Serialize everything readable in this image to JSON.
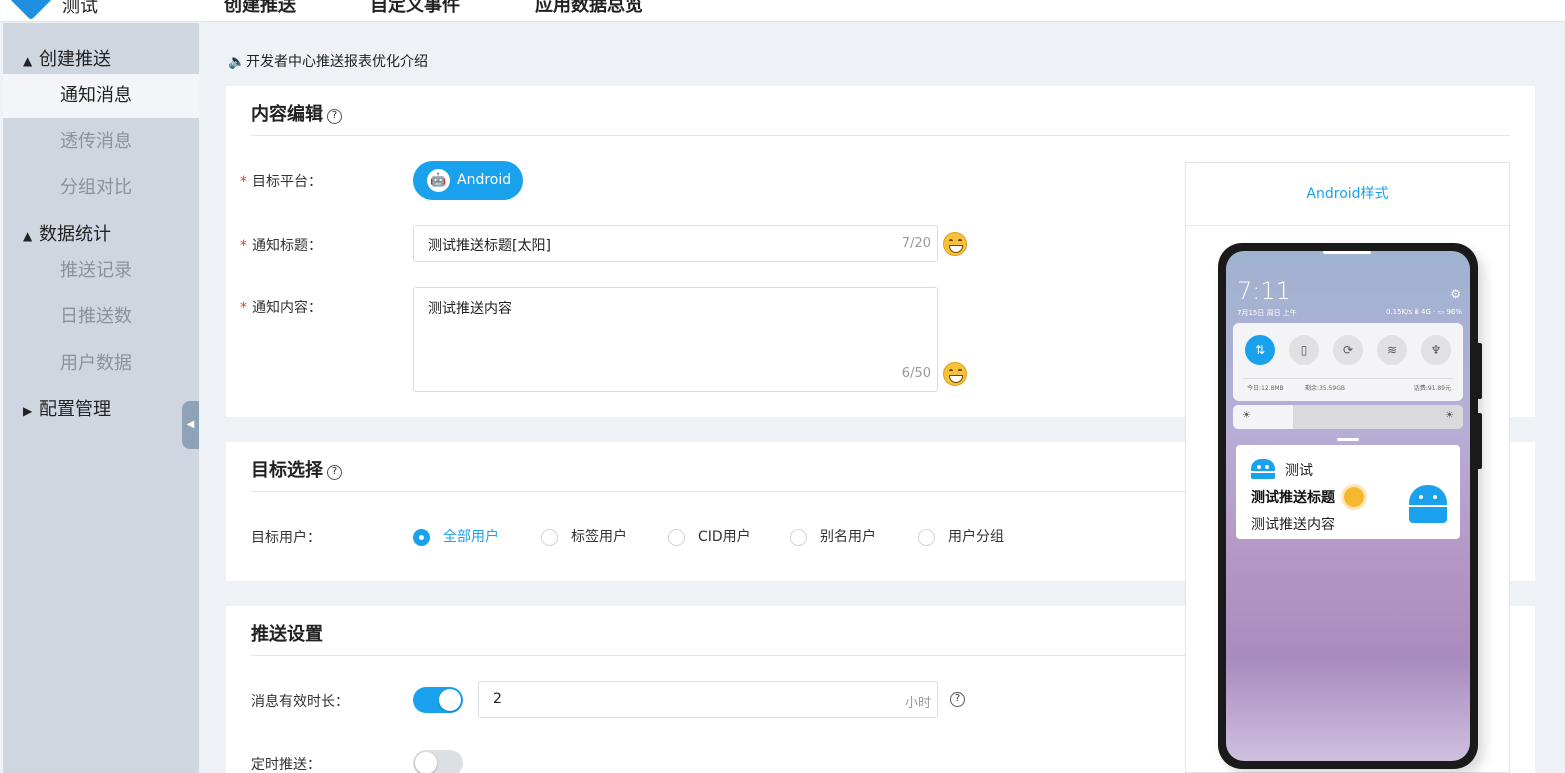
{
  "header": {
    "app_name": "测试",
    "nav": [
      "创建推送",
      "自定义事件",
      "应用数据总览"
    ]
  },
  "sidebar": {
    "groups": [
      {
        "label": "创建推送",
        "items": [
          "通知消息",
          "透传消息",
          "分组对比"
        ]
      },
      {
        "label": "数据统计",
        "items": [
          "推送记录",
          "日推送数",
          "用户数据"
        ]
      },
      {
        "label": "配置管理",
        "items": []
      }
    ],
    "active_item": "通知消息"
  },
  "notice": "开发者中心推送报表优化介绍",
  "content_edit": {
    "title": "内容编辑",
    "platform_label": "目标平台：",
    "platform_value": "Android",
    "title_label": "通知标题：",
    "title_value": "测试推送标题[太阳]",
    "title_count": "7/20",
    "content_label": "通知内容：",
    "content_value": "测试推送内容",
    "content_count": "6/50"
  },
  "target": {
    "title": "目标选择",
    "label": "目标用户：",
    "options": [
      "全部用户",
      "标签用户",
      "CID用户",
      "别名用户",
      "用户分组"
    ],
    "selected": "全部用户"
  },
  "push_settings": {
    "title": "推送设置",
    "ttl_label": "消息有效时长：",
    "ttl_value": "2",
    "ttl_unit": "小时",
    "ttl_enabled": true,
    "schedule_label": "定时推送：",
    "schedule_enabled": false
  },
  "preview": {
    "title": "Android样式",
    "clock": "7:11",
    "date": "7月15日 周日 上午",
    "status": "0.15K/s ⅲ 4G · ▭ 96%",
    "usage_today": "今日:12.8MB",
    "usage_left": "剩余:35.59GB",
    "balance": "话费:91.89元",
    "notif_app": "测试",
    "notif_title": "测试推送标题",
    "notif_content": "测试推送内容"
  },
  "colors": {
    "accent": "#1aa1ee",
    "sidebar_bg": "#cfd6df",
    "page_bg": "#eef2f7",
    "required": "#e53935"
  }
}
